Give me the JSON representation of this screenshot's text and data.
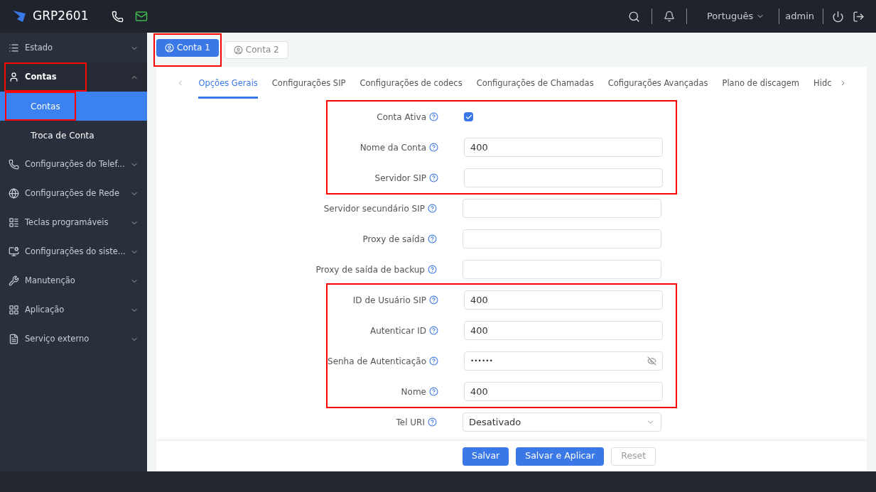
{
  "header": {
    "product": "GRP2601",
    "language": "Português",
    "user": "admin"
  },
  "sidebar": {
    "items": [
      {
        "label": "Estado",
        "expanded": false,
        "highlighted": false
      },
      {
        "label": "Contas",
        "expanded": true,
        "highlighted": true,
        "children": [
          {
            "label": "Contas",
            "selected": true,
            "highlighted": true
          },
          {
            "label": "Troca de Conta",
            "selected": false,
            "highlighted": false
          }
        ]
      },
      {
        "label": "Configurações do Telef...",
        "expanded": false,
        "highlighted": false
      },
      {
        "label": "Configurações de Rede",
        "expanded": false,
        "highlighted": false
      },
      {
        "label": "Teclas programáveis",
        "expanded": false,
        "highlighted": false
      },
      {
        "label": "Configurações do siste...",
        "expanded": false,
        "highlighted": false
      },
      {
        "label": "Manutenção",
        "expanded": false,
        "highlighted": false
      },
      {
        "label": "Aplicação",
        "expanded": false,
        "highlighted": false
      },
      {
        "label": "Serviço externo",
        "expanded": false,
        "highlighted": false
      }
    ]
  },
  "account_tabs": [
    {
      "label": "Conta 1",
      "selected": true,
      "highlighted": true
    },
    {
      "label": "Conta 2",
      "selected": false,
      "highlighted": false
    }
  ],
  "section_tabs": [
    {
      "label": "Opções Gerais",
      "selected": true
    },
    {
      "label": "Configurações SIP",
      "selected": false
    },
    {
      "label": "Configurações de codecs",
      "selected": false
    },
    {
      "label": "Configurações de Chamadas",
      "selected": false
    },
    {
      "label": "Cofigurações Avançadas",
      "selected": false
    },
    {
      "label": "Plano de discagem",
      "selected": false
    },
    {
      "label": "Hidc",
      "selected": false
    }
  ],
  "form_groups": [
    {
      "highlighted": true,
      "fields": [
        {
          "kind": "checkbox",
          "label": "Conta Ativa",
          "checked": true
        },
        {
          "kind": "text",
          "label": "Nome da Conta",
          "value": "400"
        },
        {
          "kind": "text",
          "label": "Servidor SIP"
        }
      ]
    },
    {
      "highlighted": false,
      "fields": [
        {
          "kind": "text",
          "label": "Servidor secundário SIP"
        },
        {
          "kind": "text",
          "label": "Proxy de saída"
        },
        {
          "kind": "text",
          "label": "Proxy de saída de backup"
        }
      ]
    },
    {
      "highlighted": true,
      "fields": [
        {
          "kind": "text",
          "label": "ID de Usuário SIP",
          "value": "400"
        },
        {
          "kind": "text",
          "label": "Autenticar ID",
          "value": "400"
        },
        {
          "kind": "password",
          "label": "Senha de Autenticação",
          "value": "••••••"
        },
        {
          "kind": "text",
          "label": "Nome",
          "value": "400"
        }
      ]
    },
    {
      "highlighted": false,
      "fields": [
        {
          "kind": "select",
          "label": "Tel URI",
          "value": "Desativado"
        }
      ]
    }
  ],
  "buttons": [
    {
      "label": "Salvar",
      "kind": "primary"
    },
    {
      "label": "Salvar e Aplicar",
      "kind": "primary"
    },
    {
      "label": "Reset",
      "kind": "default"
    }
  ]
}
